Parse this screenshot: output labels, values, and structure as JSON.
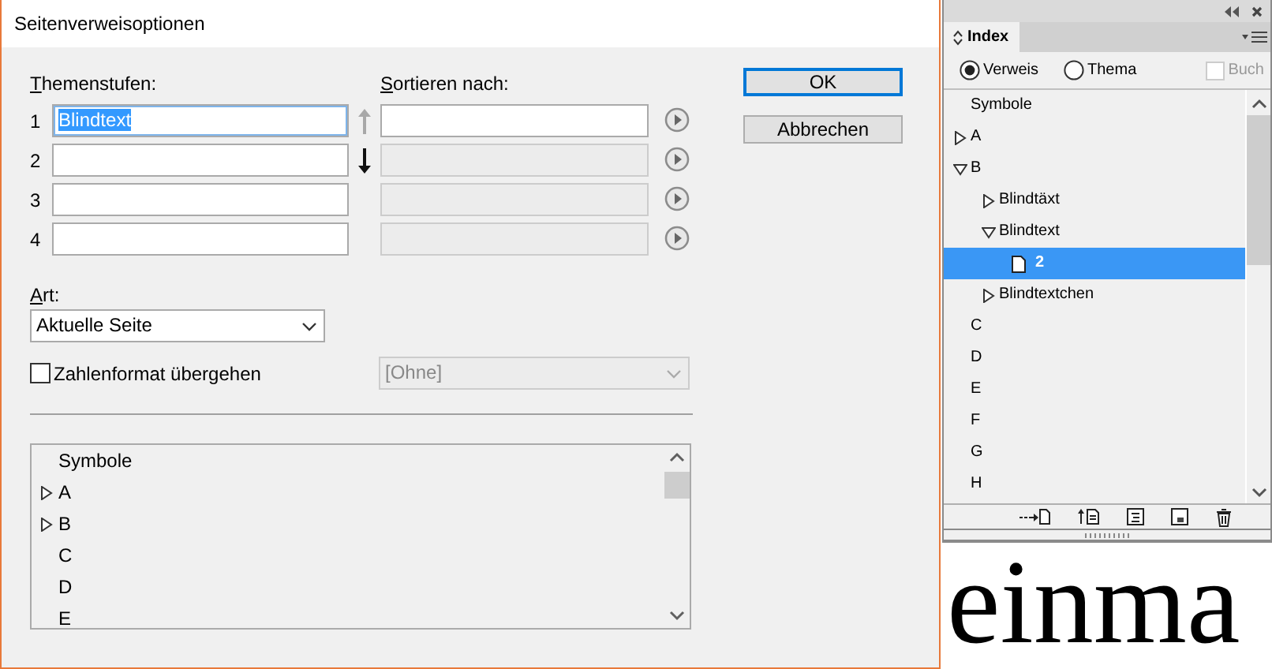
{
  "dialog": {
    "title": "Seitenverweisoptionen",
    "levels_label": "Themenstufen:",
    "sort_label": "Sortieren nach:",
    "levels": [
      {
        "number": "1",
        "value": "Blindtext",
        "text_selected": true,
        "sort_disabled": false
      },
      {
        "number": "2",
        "sort_disabled": true
      },
      {
        "number": "3",
        "sort_disabled": true
      },
      {
        "number": "4",
        "sort_disabled": true
      }
    ],
    "move_up": {
      "disabled": true
    },
    "move_down": {
      "disabled": false
    },
    "buttons": [
      {
        "label": "OK",
        "default": true
      },
      {
        "label": "Abbrechen",
        "default": false
      }
    ],
    "type_label": "Art:",
    "type_value": "Aktuelle Seite",
    "override": {
      "label": "Zahlenformat übergehen",
      "checked": false
    },
    "number_format": {
      "value": "[Ohne]",
      "disabled": true
    },
    "topic_list": [
      {
        "label": "Symbole",
        "expandable": false
      },
      {
        "label": "A",
        "expandable": true
      },
      {
        "label": "B",
        "expandable": true
      },
      {
        "label": "C",
        "expandable": false
      },
      {
        "label": "D",
        "expandable": false
      },
      {
        "label": "E",
        "expandable": false
      }
    ]
  },
  "panel": {
    "tab": "Index",
    "options": [
      {
        "kind": "radio",
        "label": "Verweis",
        "selected": true
      },
      {
        "kind": "radio",
        "label": "Thema",
        "selected": false
      },
      {
        "kind": "checkbox",
        "label": "Buch",
        "checked": false,
        "disabled": true
      }
    ],
    "tree": [
      {
        "kind": "topic",
        "label": "Symbole",
        "selected": false
      },
      {
        "kind": "topic",
        "label": "A",
        "expandable": true,
        "expanded": false,
        "selected": false
      },
      {
        "kind": "topic",
        "label": "B",
        "expandable": true,
        "expanded": true,
        "selected": false,
        "children": [
          {
            "kind": "topic",
            "label": "Blindtäxt",
            "expandable": true,
            "expanded": false,
            "selected": false
          },
          {
            "kind": "topic",
            "label": "Blindtext",
            "expandable": true,
            "expanded": true,
            "selected": false,
            "children": [
              {
                "kind": "page",
                "label": "2",
                "selected": true
              }
            ]
          },
          {
            "kind": "topic",
            "label": "Blindtextchen",
            "expandable": true,
            "expanded": false,
            "selected": false
          }
        ]
      },
      {
        "kind": "topic",
        "label": "C",
        "selected": false
      },
      {
        "kind": "topic",
        "label": "D",
        "selected": false
      },
      {
        "kind": "topic",
        "label": "E",
        "selected": false
      },
      {
        "kind": "topic",
        "label": "F",
        "selected": false
      },
      {
        "kind": "topic",
        "label": "G",
        "selected": false
      },
      {
        "kind": "topic",
        "label": "H",
        "selected": false
      }
    ]
  },
  "document_text": "einma"
}
